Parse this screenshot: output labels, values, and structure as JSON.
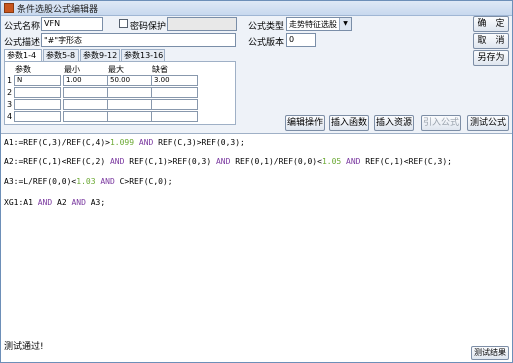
{
  "window": {
    "title": "条件选股公式编辑器"
  },
  "form": {
    "name_label": "公式名称",
    "name_value": "VFN",
    "password_label": "密码保护",
    "password_value": "",
    "desc_label": "公式描述",
    "desc_value": "\"#\"字形态",
    "type_label": "公式类型",
    "type_value": "走势特征选股",
    "version_label": "公式版本",
    "version_value": "0"
  },
  "buttons": {
    "ok": "确　定",
    "cancel": "取　消",
    "save_as": "另存为",
    "edit_op": "编辑操作",
    "insert_func": "插入函数",
    "insert_res": "插入资源",
    "import_formula": "引入公式",
    "test_formula": "测试公式",
    "test_result": "测试结果"
  },
  "tabs": [
    "参数1-4",
    "参数5-8",
    "参数9-12",
    "参数13-16"
  ],
  "params": {
    "headers": [
      "参数",
      "最小",
      "最大",
      "缺省"
    ],
    "rows": [
      {
        "num": "1",
        "name": "N",
        "min": "1.00",
        "max": "50.00",
        "def": "3.00"
      },
      {
        "num": "2",
        "name": "",
        "min": "",
        "max": "",
        "def": ""
      },
      {
        "num": "3",
        "name": "",
        "min": "",
        "max": "",
        "def": ""
      },
      {
        "num": "4",
        "name": "",
        "min": "",
        "max": "",
        "def": ""
      }
    ]
  },
  "code": [
    [
      [
        "t",
        "A1:=REF(C,3)/REF(C,4)>"
      ],
      [
        "n",
        "1.099"
      ],
      [
        "k",
        " AND "
      ],
      [
        "t",
        "REF(C,3)>REF(0,3);"
      ]
    ],
    [
      [
        "t",
        "A2:=REF(C,1)<REF(C,2)"
      ],
      [
        "k",
        " AND "
      ],
      [
        "t",
        "REF(C,1)>REF(0,3)"
      ],
      [
        "k",
        " AND "
      ],
      [
        "t",
        "REF(0,1)/REF(0,0)<"
      ],
      [
        "n",
        "1.05"
      ],
      [
        "k",
        " AND "
      ],
      [
        "t",
        "REF(C,1)<REF(C,3);"
      ]
    ],
    [
      [
        "t",
        "A3:=L/REF(0,0)<"
      ],
      [
        "n",
        "1.03"
      ],
      [
        "k",
        " AND "
      ],
      [
        "t",
        "C>REF(C,0);"
      ]
    ],
    [
      [
        "t",
        "XG1:A1"
      ],
      [
        "k",
        " AND "
      ],
      [
        "t",
        "A2"
      ],
      [
        "k",
        " AND "
      ],
      [
        "t",
        "A3;"
      ]
    ]
  ],
  "status": {
    "message": "测试通过!"
  },
  "colors": {
    "keyword": "#7b3aa0",
    "number": "#6aa832",
    "titlebar": "#c7d8ee"
  },
  "icons": {
    "title": "formula-editor-icon",
    "dropdown": "chevron-down-icon"
  }
}
